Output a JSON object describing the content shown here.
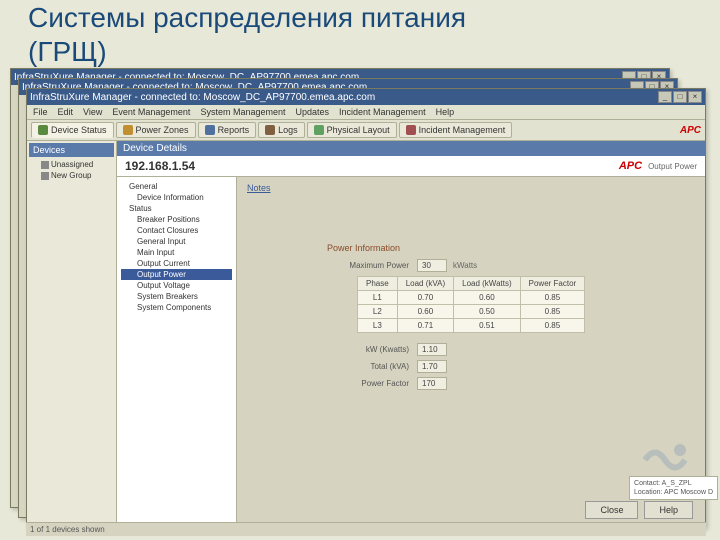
{
  "slide": {
    "title": "Системы распределения питания",
    "subtitle": "(ГРЩ)"
  },
  "windows": {
    "title_template": "InfraStruXure Manager - connected to: Moscow_DC_AP97700.emea.apc.com",
    "btn_min": "_",
    "btn_max": "□",
    "btn_close": "×"
  },
  "menu": {
    "items": [
      "File",
      "Edit",
      "View",
      "Event Management",
      "System Management",
      "Updates",
      "Incident Management",
      "Help"
    ]
  },
  "toolbar": {
    "tabs": [
      "Device Status",
      "Power Zones",
      "Reports",
      "Logs",
      "Physical Layout",
      "Incident Management"
    ],
    "brand": "APC"
  },
  "left_panel": {
    "title": "Devices",
    "items": [
      "Unassigned",
      "New Group"
    ]
  },
  "detail": {
    "title": "Device Details",
    "ip": "192.168.1.54",
    "brand": "APC",
    "sub": "Output Power",
    "notes": "Notes",
    "tree": [
      {
        "label": "General",
        "cls": ""
      },
      {
        "label": "Device Information",
        "cls": "indent1"
      },
      {
        "label": "Status",
        "cls": ""
      },
      {
        "label": "Breaker Positions",
        "cls": "indent1"
      },
      {
        "label": "Contact Closures",
        "cls": "indent1"
      },
      {
        "label": "General Input",
        "cls": "indent1"
      },
      {
        "label": "Main Input",
        "cls": "indent1"
      },
      {
        "label": "Output Current",
        "cls": "indent1"
      },
      {
        "label": "Output Power",
        "cls": "indent1 sel"
      },
      {
        "label": "Output Voltage",
        "cls": "indent1"
      },
      {
        "label": "System Breakers",
        "cls": "indent1"
      },
      {
        "label": "System Components",
        "cls": "indent1"
      }
    ]
  },
  "power": {
    "section": "Power Information",
    "max_label": "Maximum Power",
    "max_val": "30",
    "max_unit": "kWatts",
    "table": {
      "headers": [
        "Phase",
        "Load (kVA)",
        "Load (kWatts)",
        "Power Factor"
      ],
      "rows": [
        [
          "L1",
          "0.70",
          "0.60",
          "0.85"
        ],
        [
          "L2",
          "0.60",
          "0.50",
          "0.85"
        ],
        [
          "L3",
          "0.71",
          "0.51",
          "0.85"
        ]
      ]
    },
    "kw_label": "kW (Kwatts)",
    "kw_val": "1.10",
    "total_label": "Total (kVA)",
    "total_val": "1.70",
    "pf_label": "Power Factor",
    "pf_val": "170"
  },
  "buttons": {
    "close": "Close",
    "help": "Help"
  },
  "status": {
    "contact": "Contact: A_S_ZPL",
    "location": "Location: APC Moscow D",
    "bar": "1 of 1 devices shown"
  }
}
